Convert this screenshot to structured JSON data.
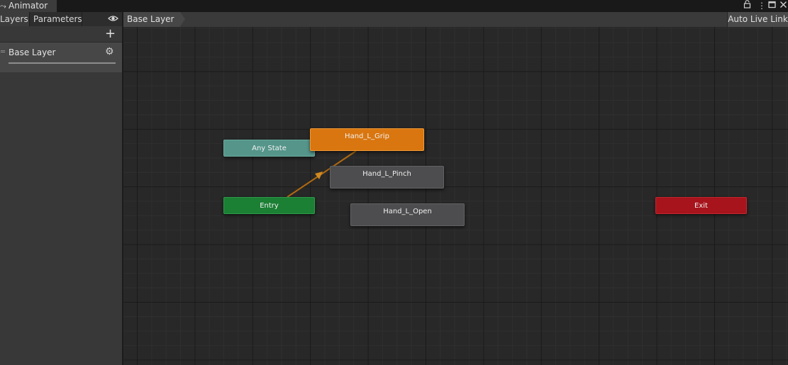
{
  "window": {
    "title": "Animator",
    "title_icon": "animator-icon",
    "controls": [
      "lock-icon",
      "kebab-menu-icon",
      "maximize-icon",
      "close-icon"
    ]
  },
  "left_panel": {
    "tabs": [
      {
        "label": "Layers",
        "active": true
      },
      {
        "label": "Parameters",
        "active": false
      }
    ],
    "visibility_icon": "eye-icon",
    "add_icon": "plus-icon",
    "layers": [
      {
        "name": "Base Layer",
        "settings_icon": "gear-icon"
      }
    ]
  },
  "graph": {
    "breadcrumb": "Base Layer",
    "auto_live_link": "Auto Live Link",
    "states": {
      "any_state": "Any State",
      "entry": "Entry",
      "exit": "Exit",
      "grip": "Hand_L_Grip",
      "pinch": "Hand_L_Pinch",
      "open": "Hand_L_Open"
    },
    "colors": {
      "any_state": "#55958a",
      "entry": "#1b7f34",
      "exit": "#a8141c",
      "default_state": "#d9760f",
      "state": "#4d4d4f",
      "transition": "#b06a10"
    },
    "transitions": [
      {
        "from": "Entry",
        "to": "Hand_L_Grip"
      }
    ]
  }
}
